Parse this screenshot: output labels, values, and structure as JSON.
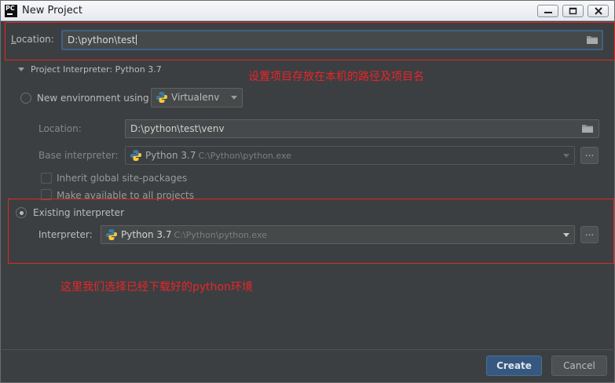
{
  "window": {
    "title": "New Project"
  },
  "location": {
    "label_prefix": "L",
    "label_rest": "ocation:",
    "value": "D:\\python\\test"
  },
  "section": {
    "title": "Project Interpreter: Python 3.7"
  },
  "new_env": {
    "label": "New environment using",
    "tool": "Virtualenv",
    "location_label": "Location:",
    "location_value": "D:\\python\\test\\venv",
    "base_label": "Base interpreter:",
    "base_version": "Python 3.7",
    "base_path": "C:\\Python\\python.exe",
    "inherit_label": "Inherit global site-packages",
    "available_label": "Make available to all projects"
  },
  "existing": {
    "label": "Existing interpreter",
    "interp_label": "Interpreter:",
    "interp_version": "Python 3.7",
    "interp_path": "C:\\Python\\python.exe"
  },
  "annotations": {
    "top": "设置项目存放在本机的路径及项目名",
    "bottom": "这里我们选择已经下载好的python环境"
  },
  "buttons": {
    "create": "Create",
    "cancel": "Cancel",
    "browse": "..."
  },
  "colors": {
    "annotation": "#e8252a",
    "accent": "#365880",
    "background": "#3c3f41"
  }
}
